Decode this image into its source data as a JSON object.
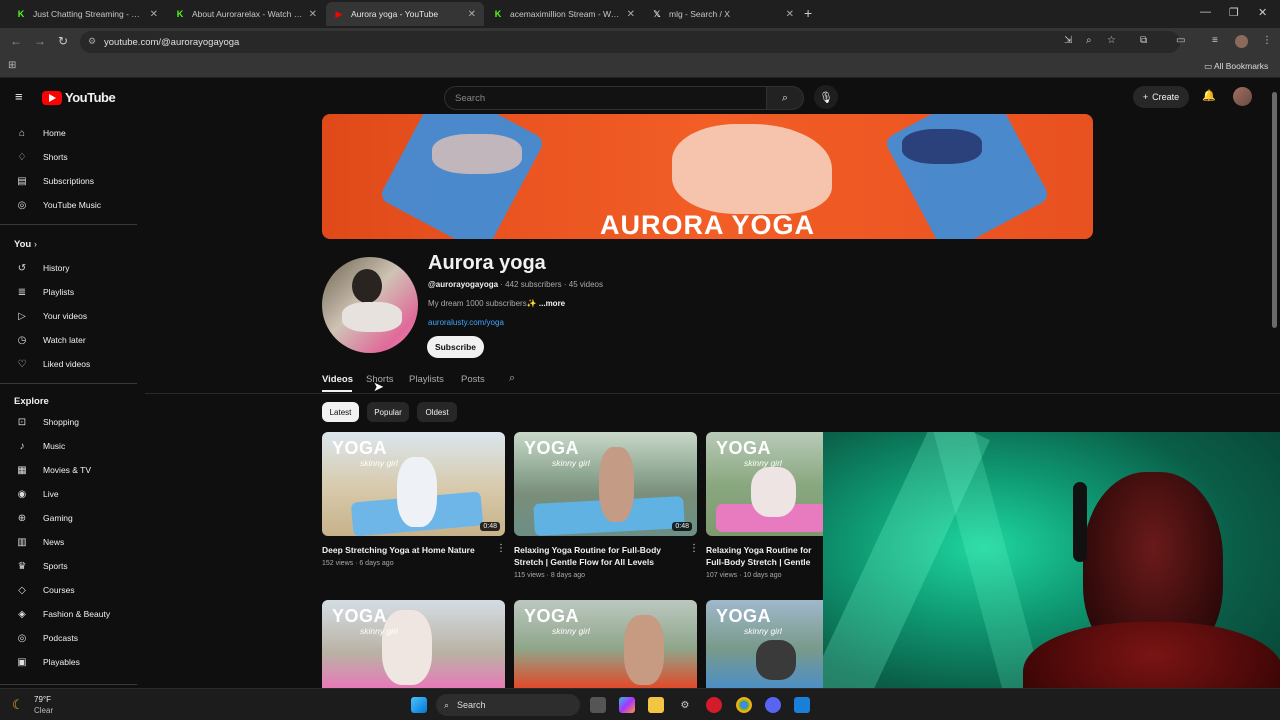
{
  "browser": {
    "tabs": [
      {
        "title": "Just Chatting Streaming - Live",
        "favicon": "K",
        "color": "#53fc18",
        "active": false
      },
      {
        "title": "About Aurorarelax - Watch Live",
        "favicon": "K",
        "color": "#53fc18",
        "active": false
      },
      {
        "title": "Aurora yoga - YouTube",
        "favicon": "▶",
        "color": "#ff0000",
        "active": true
      },
      {
        "title": "acemaximillion Stream - Watch",
        "favicon": "K",
        "color": "#53fc18",
        "active": false
      },
      {
        "title": "mlg - Search / X",
        "favicon": "𝕏",
        "color": "#ffffff",
        "active": false
      }
    ],
    "url": "youtube.com/@aurorayogayoga",
    "bookmarks_label": "All Bookmarks"
  },
  "youtube": {
    "logo_text": "YouTube",
    "search_placeholder": "Search",
    "create_label": "Create",
    "sidebar": {
      "main": [
        {
          "label": "Home",
          "icon": "home-icon",
          "glyph": "⌂"
        },
        {
          "label": "Shorts",
          "icon": "shorts-icon",
          "glyph": "♢"
        },
        {
          "label": "Subscriptions",
          "icon": "subscriptions-icon",
          "glyph": "▤"
        },
        {
          "label": "YouTube Music",
          "icon": "music-circle-icon",
          "glyph": "◎"
        }
      ],
      "you_header": "You",
      "you": [
        {
          "label": "History",
          "icon": "history-icon",
          "glyph": "↺"
        },
        {
          "label": "Playlists",
          "icon": "playlists-icon",
          "glyph": "≣"
        },
        {
          "label": "Your videos",
          "icon": "your-videos-icon",
          "glyph": "▷"
        },
        {
          "label": "Watch later",
          "icon": "clock-icon",
          "glyph": "◷"
        },
        {
          "label": "Liked videos",
          "icon": "thumb-up-icon",
          "glyph": "♡"
        }
      ],
      "explore_header": "Explore",
      "explore": [
        {
          "label": "Shopping",
          "icon": "shopping-icon",
          "glyph": "⊡"
        },
        {
          "label": "Music",
          "icon": "music-note-icon",
          "glyph": "♪"
        },
        {
          "label": "Movies & TV",
          "icon": "movies-icon",
          "glyph": "▦"
        },
        {
          "label": "Live",
          "icon": "live-icon",
          "glyph": "◉"
        },
        {
          "label": "Gaming",
          "icon": "gaming-icon",
          "glyph": "⊕"
        },
        {
          "label": "News",
          "icon": "news-icon",
          "glyph": "▥"
        },
        {
          "label": "Sports",
          "icon": "sports-icon",
          "glyph": "♛"
        },
        {
          "label": "Courses",
          "icon": "courses-icon",
          "glyph": "◇"
        },
        {
          "label": "Fashion & Beauty",
          "icon": "fashion-icon",
          "glyph": "◈"
        },
        {
          "label": "Podcasts",
          "icon": "podcasts-icon",
          "glyph": "◎"
        },
        {
          "label": "Playables",
          "icon": "playables-icon",
          "glyph": "▣"
        }
      ]
    },
    "channel": {
      "banner_text": "AURORA YOGA",
      "name": "Aurora yoga",
      "handle": "@aurorayogayoga",
      "meta": " · 442 subscribers · 45 videos",
      "description": "My dream 1000 subscribers✨",
      "more": " ...more",
      "link": "auroralusty.com/yoga",
      "subscribe_label": "Subscribe",
      "tabs": [
        "Videos",
        "Shorts",
        "Playlists",
        "Posts"
      ],
      "chips": [
        "Latest",
        "Popular",
        "Oldest"
      ]
    },
    "videos": [
      {
        "title": "Deep Stretching Yoga at Home Nature",
        "meta": "152 views · 6 days ago",
        "duration": "0:48"
      },
      {
        "title": "Relaxing Yoga Routine for Full-Body Stretch | Gentle Flow for All Levels",
        "meta": "115 views · 8 days ago",
        "duration": "0:48"
      },
      {
        "title": "Relaxing Yoga Routine for Full-Body Stretch | Gentle Flow for All Levels",
        "meta": "107 views · 10 days ago",
        "duration": ""
      }
    ],
    "thumb_text": {
      "big": "YOGA",
      "small": "skinny girl"
    }
  },
  "taskbar": {
    "weather_temp": "79°F",
    "weather_cond": "Clear",
    "search_label": "Search"
  }
}
